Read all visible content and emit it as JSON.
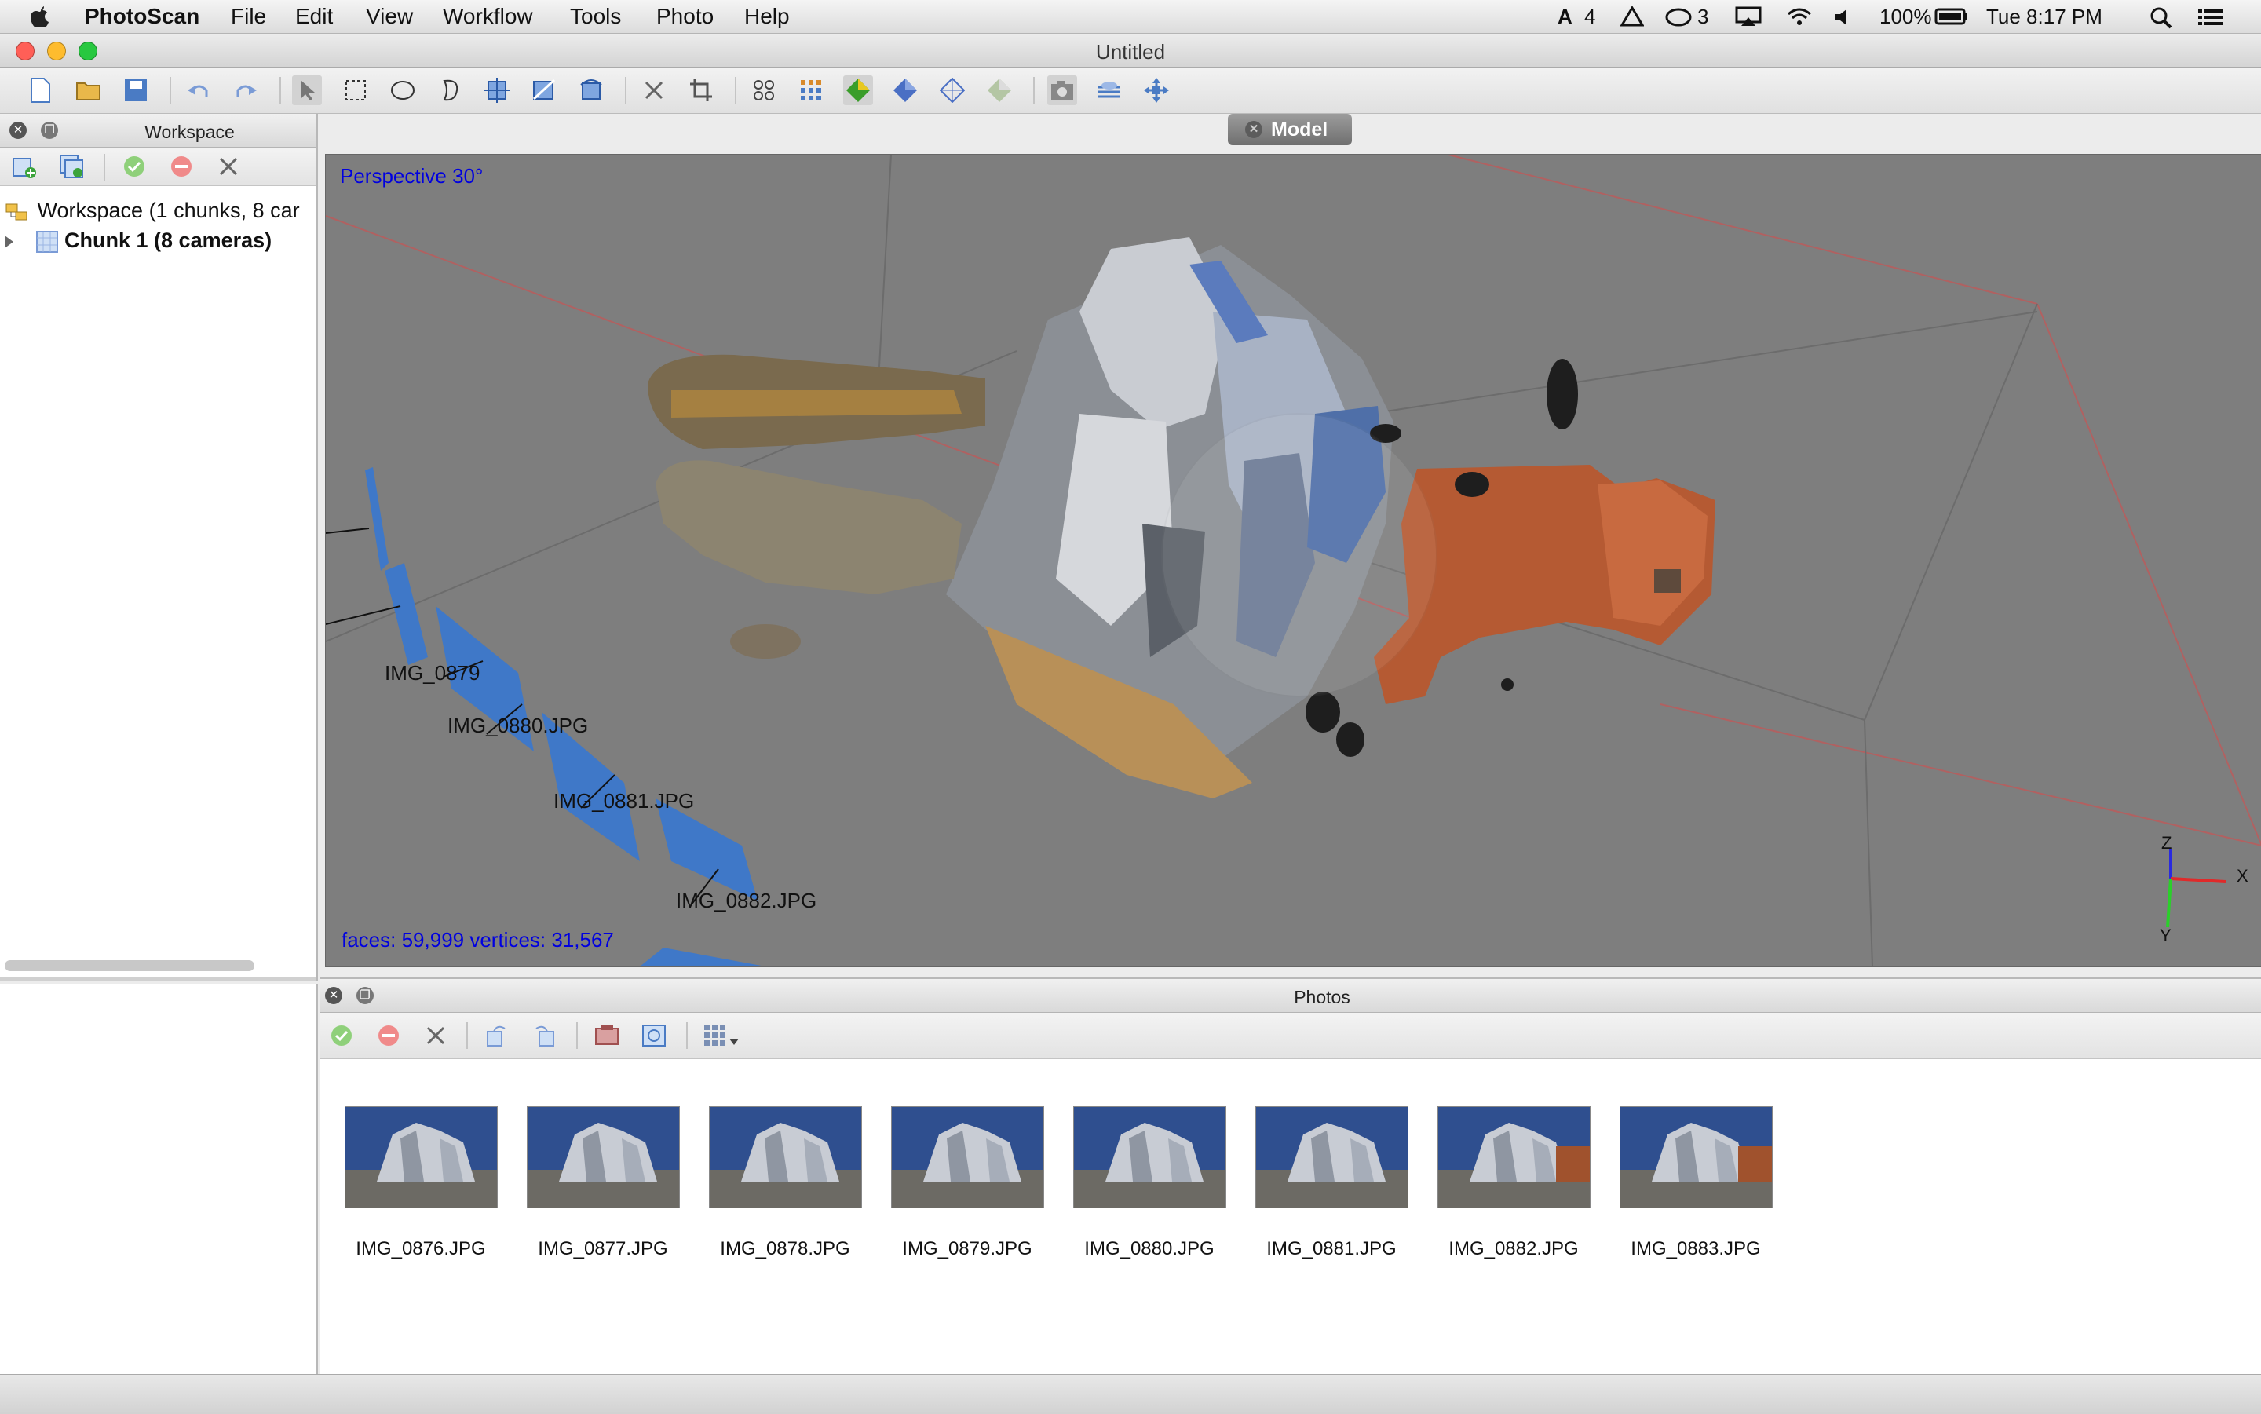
{
  "menubar": {
    "app_name": "PhotoScan",
    "items": [
      "File",
      "Edit",
      "View",
      "Workflow",
      "Tools",
      "Photo",
      "Help"
    ],
    "status": {
      "adobe_count": "4",
      "cc_count": "3",
      "battery": "100%",
      "clock": "Tue 8:17 PM"
    }
  },
  "window": {
    "title": "Untitled"
  },
  "workspace": {
    "title": "Workspace",
    "tree": [
      {
        "label": "Workspace (1 chunks, 8 car"
      },
      {
        "label": "Chunk 1 (8 cameras)"
      }
    ]
  },
  "model": {
    "tab_label": "Model",
    "perspective": "Perspective 30°",
    "stats": "faces: 59,999 vertices: 31,567",
    "axes": {
      "z": "Z",
      "x": "X",
      "y": "Y"
    },
    "camera_labels": [
      "IMG_0879",
      "IMG_0880.JPG",
      "IMG_0881.JPG",
      "IMG_0882.JPG"
    ]
  },
  "photos": {
    "title": "Photos",
    "items": [
      {
        "name": "IMG_0876.JPG"
      },
      {
        "name": "IMG_0877.JPG"
      },
      {
        "name": "IMG_0878.JPG"
      },
      {
        "name": "IMG_0879.JPG"
      },
      {
        "name": "IMG_0880.JPG"
      },
      {
        "name": "IMG_0881.JPG"
      },
      {
        "name": "IMG_0882.JPG"
      },
      {
        "name": "IMG_0883.JPG"
      }
    ]
  },
  "icons": {
    "toolbar": [
      "new-icon",
      "open-icon",
      "save-icon",
      "undo-icon",
      "redo-icon",
      "pointer-icon",
      "rect-select-icon",
      "circle-select-icon",
      "free-select-icon",
      "move-region-icon",
      "resize-region-icon",
      "rotate-region-icon",
      "delete-icon",
      "crop-icon",
      "points-icon",
      "dense-cloud-icon",
      "shaded-model-icon",
      "solid-model-icon",
      "wireframe-icon",
      "textured-icon",
      "camera-icon",
      "ground-plane-icon",
      "reset-view-icon"
    ]
  },
  "colors": {
    "viewport_bg": "#7e7e7e",
    "overlay_text": "#0000e0",
    "camera_plane": "#3f78c8"
  }
}
